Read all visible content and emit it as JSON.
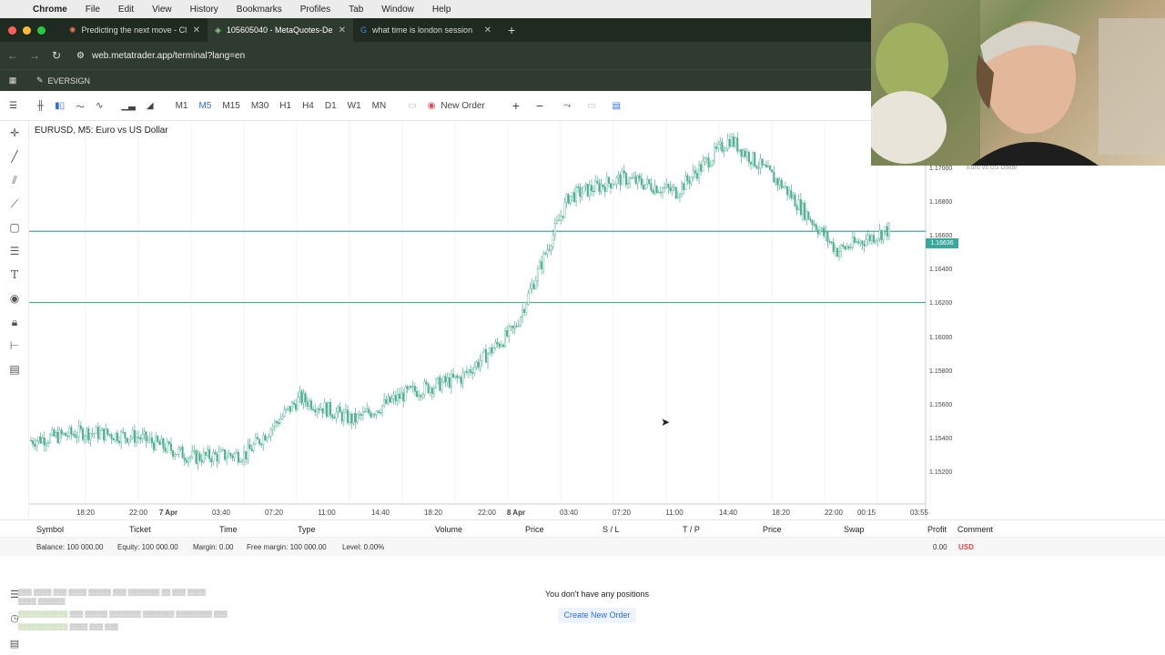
{
  "macos_menu": {
    "apple_icon": "apple-icon",
    "app": "Chrome",
    "items": [
      "File",
      "Edit",
      "View",
      "History",
      "Bookmarks",
      "Profiles",
      "Tab",
      "Window",
      "Help"
    ]
  },
  "browser": {
    "tabs": [
      {
        "label": "Predicting the next move - Cl"
      },
      {
        "label": "105605040 - MetaQuotes-De"
      },
      {
        "label": "what time is london session"
      }
    ],
    "url": "web.metatrader.app/terminal?lang=en",
    "bookmark": "EVERSIGN"
  },
  "toolbar": {
    "timeframes": [
      "M1",
      "M5",
      "M15",
      "M30",
      "H1",
      "H4",
      "D1",
      "W1",
      "MN"
    ],
    "active_timeframe": "M5",
    "new_order": "New Order"
  },
  "chart": {
    "title": "EURUSD, M5: Euro vs US Dollar",
    "right_title": "Euro vs US Dollar",
    "current_price": "1.16636",
    "y_ticks": [
      "1.17000",
      "1.16800",
      "1.16600",
      "1.16400",
      "1.16200",
      "1.16000",
      "1.15800",
      "1.15600",
      "1.15400",
      "1.15200"
    ],
    "x_ticks": [
      "18:20",
      "22:00",
      "7 Apr",
      "03:40",
      "07:20",
      "11:00",
      "14:40",
      "18:20",
      "22:00",
      "8 Apr",
      "03:40",
      "07:20",
      "11:00",
      "14:40",
      "18:20",
      "22:00",
      "00:15",
      "03:55"
    ],
    "colors": {
      "candles": "#4caf8e",
      "hline": "#4aa89d"
    }
  },
  "chart_data": {
    "type": "line",
    "title": "EURUSD, M5: Euro vs US Dollar",
    "ylim": [
      1.151,
      1.1725
    ],
    "x": [
      "18:20",
      "22:00",
      "7 Apr",
      "03:40",
      "07:20",
      "11:00",
      "14:40",
      "18:20",
      "22:00",
      "8 Apr",
      "03:40",
      "07:20",
      "11:00",
      "14:40",
      "18:20",
      "22:00",
      "00:15"
    ],
    "series": [
      {
        "values": [
          1.154,
          1.1545,
          1.1542,
          1.153,
          1.1532,
          1.1565,
          1.1552,
          1.1568,
          1.1577,
          1.1606,
          1.1684,
          1.1695,
          1.1687,
          1.1718,
          1.169,
          1.1652,
          1.1665
        ]
      }
    ],
    "hlines": [
      1.16636,
      1.16215
    ]
  },
  "positions_table": {
    "headers": [
      "Symbol",
      "Ticket",
      "Time",
      "Type",
      "Volume",
      "Price",
      "S / L",
      "T / P",
      "Price",
      "Swap",
      "Profit",
      "Comment"
    ],
    "balance": "Balance: 100 000.00",
    "equity": "Equity: 100 000.00",
    "margin": "Margin: 0.00",
    "free_margin": "Free margin: 100 000.00",
    "level": "Level: 0.00%",
    "profit": "0.00",
    "currency": "USD",
    "empty_text": "You don't have any positions",
    "create_button": "Create New Order"
  }
}
